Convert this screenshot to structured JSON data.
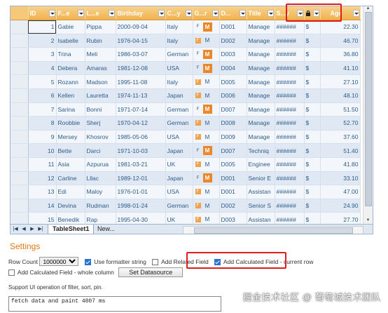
{
  "sheet": {
    "columns": [
      {
        "label": "ID",
        "dropdown": true
      },
      {
        "label": "F...e",
        "dropdown": true
      },
      {
        "label": "L...e",
        "dropdown": true
      },
      {
        "label": "Birthday",
        "dropdown": true
      },
      {
        "label": "C...y",
        "dropdown": true
      },
      {
        "label": "G...r",
        "dropdown": true
      },
      {
        "label": "D...",
        "dropdown": true
      },
      {
        "label": "Title",
        "dropdown": true
      },
      {
        "label": "S...y",
        "dropdown": true
      },
      {
        "label": "",
        "dropdown": true,
        "lock": true
      },
      {
        "label": "Age",
        "dropdown": true
      }
    ],
    "rows": [
      {
        "id": "1",
        "first": "Gabie",
        "last": "Pippa",
        "birthday": "2000-09-04",
        "country": "Italy",
        "gender": "M",
        "dept": "D001",
        "title": "Manage",
        "salary": "######",
        "currency": "$",
        "age": "22.30"
      },
      {
        "id": "2",
        "first": "Isabelle",
        "last": "Rubin",
        "birthday": "1976-04-15",
        "country": "Italy",
        "gender": "F",
        "dept": "D002",
        "title": "Manage",
        "salary": "######",
        "currency": "$",
        "age": "46.70"
      },
      {
        "id": "3",
        "first": "Trina",
        "last": "Meli",
        "birthday": "1986-03-07",
        "country": "German",
        "gender": "M",
        "dept": "D003",
        "title": "Manage",
        "salary": "######",
        "currency": "$",
        "age": "36.80"
      },
      {
        "id": "4",
        "first": "Debera",
        "last": "Amaras",
        "birthday": "1981-12-08",
        "country": "USA",
        "gender": "M",
        "dept": "D004",
        "title": "Manage",
        "salary": "######",
        "currency": "$",
        "age": "41.10"
      },
      {
        "id": "5",
        "first": "Rozann",
        "last": "Madson",
        "birthday": "1995-11-08",
        "country": "Italy",
        "gender": "F",
        "dept": "D005",
        "title": "Manage",
        "salary": "######",
        "currency": "$",
        "age": "27.10"
      },
      {
        "id": "6",
        "first": "Kellen",
        "last": "Lauretta",
        "birthday": "1974-11-13",
        "country": "Japan",
        "gender": "F",
        "dept": "D006",
        "title": "Manage",
        "salary": "######",
        "currency": "$",
        "age": "48.10"
      },
      {
        "id": "7",
        "first": "Sarina",
        "last": "Bonni",
        "birthday": "1971-07-14",
        "country": "German",
        "gender": "M",
        "dept": "D007",
        "title": "Manage",
        "salary": "######",
        "currency": "$",
        "age": "51.50"
      },
      {
        "id": "8",
        "first": "Roobbie",
        "last": "Sherj",
        "birthday": "1970-04-12",
        "country": "German",
        "gender": "F",
        "dept": "D008",
        "title": "Manage",
        "salary": "######",
        "currency": "$",
        "age": "52.70"
      },
      {
        "id": "9",
        "first": "Mersey",
        "last": "Khosrov",
        "birthday": "1985-05-06",
        "country": "USA",
        "gender": "F",
        "dept": "D009",
        "title": "Manage",
        "salary": "######",
        "currency": "$",
        "age": "37.60"
      },
      {
        "id": "10",
        "first": "Bette",
        "last": "Darci",
        "birthday": "1971-10-03",
        "country": "Japan",
        "gender": "M",
        "dept": "D007",
        "title": "Techniq",
        "salary": "######",
        "currency": "$",
        "age": "51.40"
      },
      {
        "id": "11",
        "first": "Asia",
        "last": "Azpurua",
        "birthday": "1981-03-21",
        "country": "UK",
        "gender": "F",
        "dept": "D005",
        "title": "Enginee",
        "salary": "######",
        "currency": "$",
        "age": "41.80"
      },
      {
        "id": "12",
        "first": "Carline",
        "last": "Lllac",
        "birthday": "1989-12-01",
        "country": "Japan",
        "gender": "M",
        "dept": "D001",
        "title": "Senior E",
        "salary": "######",
        "currency": "$",
        "age": "33.10"
      },
      {
        "id": "13",
        "first": "Edi",
        "last": "Maloy",
        "birthday": "1976-01-01",
        "country": "USA",
        "gender": "F",
        "dept": "D001",
        "title": "Assistan",
        "salary": "######",
        "currency": "$",
        "age": "47.00"
      },
      {
        "id": "14",
        "first": "Devina",
        "last": "Rudman",
        "birthday": "1998-01-24",
        "country": "German",
        "gender": "F",
        "dept": "D002",
        "title": "Senior S",
        "salary": "######",
        "currency": "$",
        "age": "24.90"
      },
      {
        "id": "15",
        "first": "Benedik",
        "last": "Rap",
        "birthday": "1995-04-30",
        "country": "UK",
        "gender": "F",
        "dept": "D003",
        "title": "Assistan",
        "salary": "######",
        "currency": "$",
        "age": "27.70"
      }
    ],
    "tabs": [
      {
        "label": "TableSheet1",
        "active": true
      },
      {
        "label": "New...",
        "active": false
      }
    ],
    "nav_icons": [
      "first-sheet-icon",
      "prev-sheet-icon",
      "next-sheet-icon",
      "last-sheet-icon"
    ],
    "colors": {
      "header": "#f2b24d",
      "row_alt": "#dfe8f3",
      "cell_text": "#2f5d8c",
      "highlight": "#e21b1b"
    }
  },
  "settings": {
    "title": "Settings",
    "row_count_label": "Row Count",
    "row_count_value": "1000000",
    "row_count_options": [
      "1000000"
    ],
    "use_formatter_label": "Use formatter string",
    "use_formatter_checked": true,
    "add_related_label": "Add Related Field",
    "add_related_checked": false,
    "calc_current_label": "Add Calculated Field - current row",
    "calc_current_checked": true,
    "calc_whole_label": "Add Calculated Field - whole column",
    "calc_whole_checked": false,
    "set_datasource_label": "Set Datasource",
    "support_text": "Support UI operation of filter, sort, pin.",
    "log_text": "fetch data and paint 4807 ms",
    "accent_color": "#e07b1a"
  },
  "watermark": "掘金技术社区 @ 葡萄城技术团队"
}
